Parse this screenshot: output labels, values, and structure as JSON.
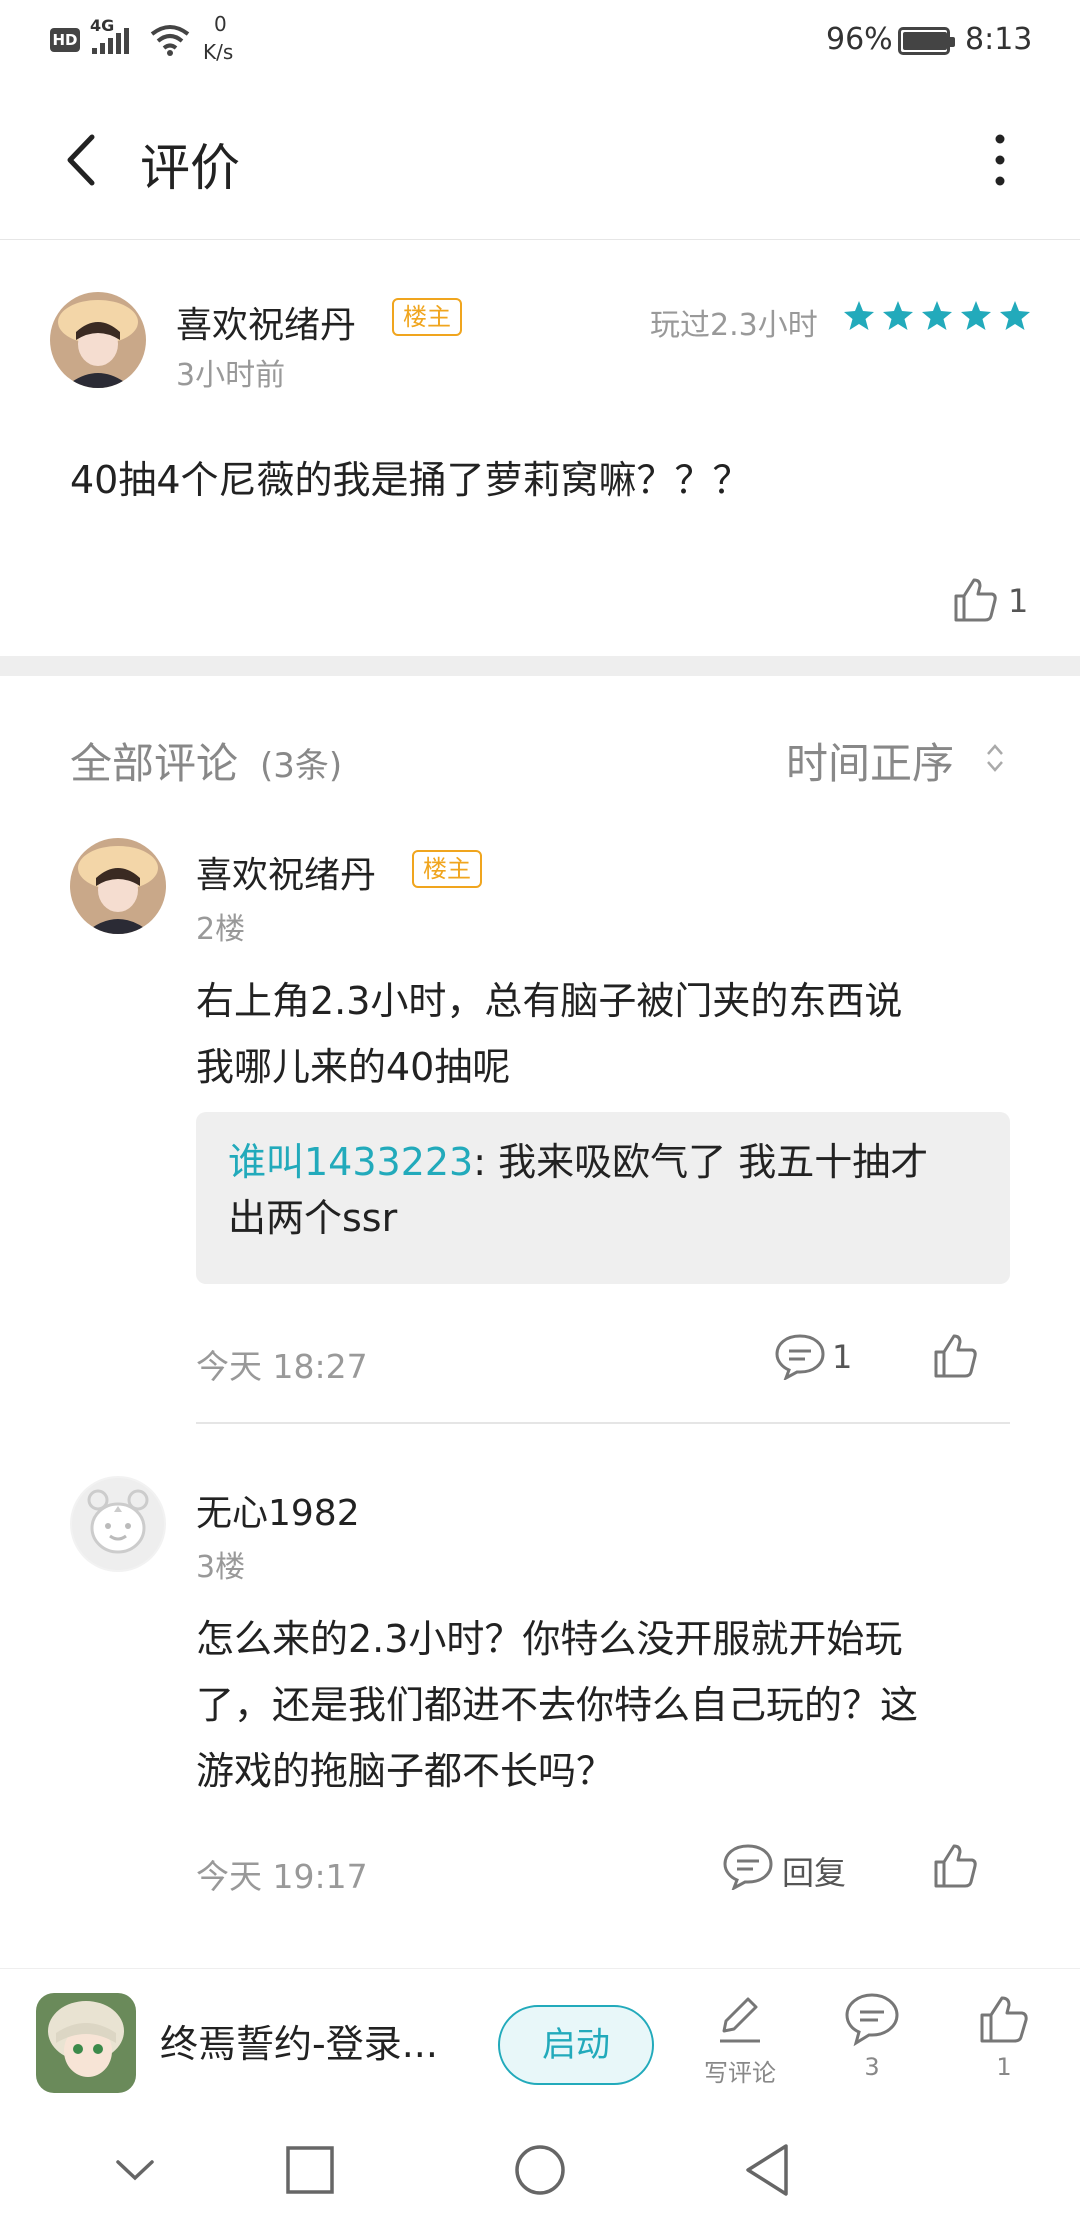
{
  "status_bar": {
    "hd": "HD",
    "network": "4G",
    "speed_value": "0",
    "speed_unit": "K/s",
    "battery": "96%",
    "battery_level": 0.96,
    "time": "8:13"
  },
  "header": {
    "title": "评价"
  },
  "post": {
    "author": "喜欢祝绪丹",
    "badge": "楼主",
    "time": "3小时前",
    "played": "玩过2.3小时",
    "rating": 5,
    "content": "40抽4个尼薇的我是捅了萝莉窝嘛？？？",
    "likes": "1"
  },
  "comments_section": {
    "title": "全部评论",
    "count": "(3条)",
    "sort": "时间正序"
  },
  "comments": [
    {
      "author": "喜欢祝绪丹",
      "badge": "楼主",
      "floor": "2楼",
      "line1": "右上角2.3小时，总有脑子被门夹的东西说",
      "line2": "我哪儿来的40抽呢",
      "reply_user": "谁叫1433223",
      "reply_text_1": ": 我来吸欧气了 我五十抽才",
      "reply_text_2": "出两个ssr",
      "time": "今天 18:27",
      "reply_count": "1"
    },
    {
      "author": "无心1982",
      "floor": "3楼",
      "line1": "怎么来的2.3小时？你特么没开服就开始玩",
      "line2": "了，还是我们都进不去你特么自己玩的？这",
      "line3": "游戏的拖脑子都不长吗？",
      "time": "今天 19:17",
      "reply_label": "回复"
    }
  ],
  "bottom_bar": {
    "game_name": "终焉誓约-登录...",
    "start_label": "启动",
    "write_label": "写评论",
    "comment_count": "3",
    "like_count": "1"
  },
  "colors": {
    "accent": "#22aabb",
    "badge": "#f0a51e",
    "gray": "#999999"
  }
}
